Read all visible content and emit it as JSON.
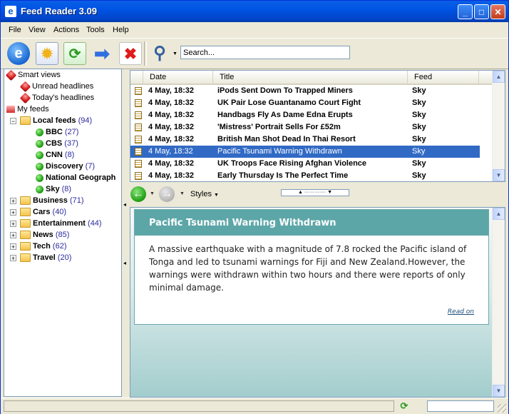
{
  "window": {
    "title": "Feed Reader 3.09",
    "controls": {
      "minimize": "_",
      "maximize": "□",
      "close": "✕"
    }
  },
  "menu": [
    "File",
    "View",
    "Actions",
    "Tools",
    "Help"
  ],
  "toolbar": {
    "icons": [
      "feed-reader-icon",
      "new-feed-icon",
      "refresh-icon",
      "forward-arrow-icon",
      "delete-icon",
      "search-magnifier-icon"
    ],
    "search_placeholder": "Search..."
  },
  "tree": {
    "smart_views": "Smart views",
    "unread_headlines": "Unread headlines",
    "todays_headlines": "Today's headlines",
    "my_feeds": "My feeds",
    "local_feeds": {
      "label": "Local feeds",
      "count": "(94)"
    },
    "local_children": [
      {
        "label": "BBC",
        "count": "(27)"
      },
      {
        "label": "CBS",
        "count": "(37)"
      },
      {
        "label": "CNN",
        "count": "(8)"
      },
      {
        "label": "Discovery",
        "count": "(7)"
      },
      {
        "label": "National Geograph",
        "count": ""
      },
      {
        "label": "Sky",
        "count": "(8)"
      }
    ],
    "folders": [
      {
        "label": "Business",
        "count": "(71)"
      },
      {
        "label": "Cars",
        "count": "(40)"
      },
      {
        "label": "Entertainment",
        "count": "(44)"
      },
      {
        "label": "News",
        "count": "(85)"
      },
      {
        "label": "Tech",
        "count": "(62)"
      },
      {
        "label": "Travel",
        "count": "(20)"
      }
    ]
  },
  "headlines": {
    "columns": {
      "date": "Date",
      "title": "Title",
      "feed": "Feed"
    },
    "rows": [
      {
        "date": "4 May, 18:32",
        "title": "iPods Sent Down To Trapped Miners",
        "feed": "Sky"
      },
      {
        "date": "4 May, 18:32",
        "title": "UK Pair Lose Guantanamo Court Fight",
        "feed": "Sky"
      },
      {
        "date": "4 May, 18:32",
        "title": "Handbags Fly As Dame Edna Erupts",
        "feed": "Sky"
      },
      {
        "date": "4 May, 18:32",
        "title": "'Mistress' Portrait Sells For £52m",
        "feed": "Sky"
      },
      {
        "date": "4 May, 18:32",
        "title": "British Man Shot Dead In Thai Resort",
        "feed": "Sky"
      },
      {
        "date": "4 May, 18:32",
        "title": "Pacific Tsunami Warning Withdrawn",
        "feed": "Sky"
      },
      {
        "date": "4 May, 18:32",
        "title": "UK Troops Face Rising Afghan Violence",
        "feed": "Sky"
      },
      {
        "date": "4 May, 18:32",
        "title": "Early Thursday Is The Perfect Time",
        "feed": "Sky"
      }
    ],
    "selected_index": 5
  },
  "viewer": {
    "styles_label": "Styles",
    "article": {
      "title": "Pacific Tsunami Warning Withdrawn",
      "body": "A massive earthquake with a magnitude of 7.8 rocked the Pacific island of Tonga and led to tsunami warnings for Fiji and New Zealand.However, the warnings were withdrawn within two hours and there were reports of only minimal damage.",
      "read_on": "Read on"
    }
  },
  "colors": {
    "titlebar": "#0054e3",
    "selection": "#316ac5",
    "article_header": "#5da6a8",
    "count_text": "#2a2a9f"
  }
}
